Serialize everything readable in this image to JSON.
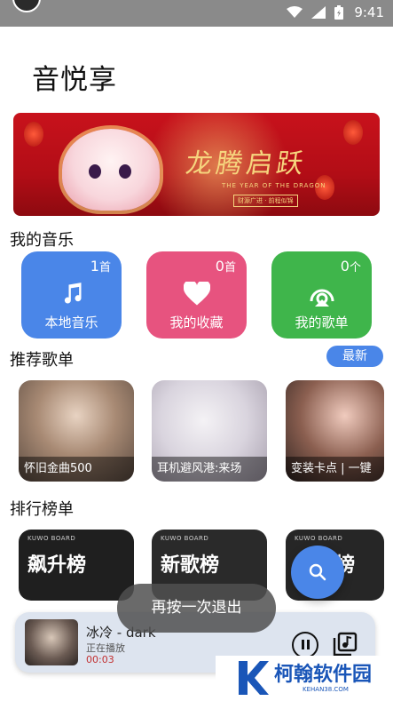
{
  "status_bar": {
    "time": "9:41"
  },
  "app": {
    "title": "音悦享"
  },
  "banner": {
    "headline": "龙腾启跃",
    "sub_en": "THE YEAR OF THE DRAGON",
    "sub_cn": "财源广进 · 前程似锦"
  },
  "my_music": {
    "title": "我的音乐",
    "cards": [
      {
        "label": "本地音乐",
        "count": "1",
        "unit": "首",
        "icon": "music-note-icon",
        "color": "#4a86e8"
      },
      {
        "label": "我的收藏",
        "count": "0",
        "unit": "首",
        "icon": "heart-icon",
        "color": "#e7537f"
      },
      {
        "label": "我的歌单",
        "count": "0",
        "unit": "个",
        "icon": "playlist-icon",
        "color": "#3fb54b"
      }
    ]
  },
  "recommend": {
    "title": "推荐歌单",
    "latest_label": "最新",
    "items": [
      {
        "caption": "怀旧金曲500"
      },
      {
        "caption": "耳机避风港:来场"
      },
      {
        "caption": "变装卡点 | 一键"
      }
    ]
  },
  "rankings": {
    "title": "排行榜单",
    "items": [
      {
        "name": "飙升榜",
        "brand": "KUWO BOARD"
      },
      {
        "name": "新歌榜",
        "brand": "KUWO BOARD"
      },
      {
        "name": "榜",
        "brand": "KUWO BOARD"
      }
    ]
  },
  "player": {
    "song": "冰冷 - dark",
    "state": "正在播放",
    "time": "00:03"
  },
  "toast": {
    "text": "再按一次退出"
  },
  "watermark": {
    "text": "柯翰软件园",
    "sub": "KEHAN38.COM"
  }
}
